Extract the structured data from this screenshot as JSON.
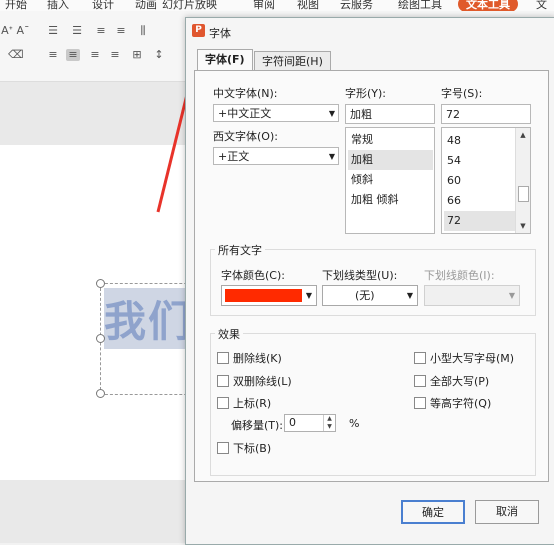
{
  "ribbon": {
    "menu": [
      "开始",
      "插入",
      "设计",
      "动画",
      "幻灯片放映",
      "审阅",
      "视图",
      "云服务",
      "绘图工具",
      "文本工具",
      "文"
    ]
  },
  "slide": {
    "text": "我们"
  },
  "dialog": {
    "title": "字体",
    "tabs": [
      "字体(F)",
      "字符间距(H)"
    ],
    "cn_font_label": "中文字体(N):",
    "cn_font_value": "+中文正文",
    "western_font_label": "西文字体(O):",
    "western_font_value": "+正文",
    "style_label": "字形(Y):",
    "style_value": "加粗",
    "style_options": [
      "常规",
      "加粗",
      "倾斜",
      "加粗 倾斜"
    ],
    "style_selected": "加粗",
    "size_label": "字号(S):",
    "size_value": "72",
    "size_options": [
      "48",
      "54",
      "60",
      "66",
      "72"
    ],
    "size_selected": "72",
    "all_text_title": "所有文字",
    "color_label": "字体颜色(C):",
    "color_value": "#ff2a00",
    "underline_label": "下划线类型(U):",
    "underline_value": "(无)",
    "underline_color_label": "下划线颜色(I):",
    "effects_title": "效果",
    "effects_left": [
      "删除线(K)",
      "双删除线(L)",
      "上标(R)"
    ],
    "offset_label": "偏移量(T):",
    "offset_value": "0",
    "offset_unit": "%",
    "subscript_label": "下标(B)",
    "effects_right": [
      "小型大写字母(M)",
      "全部大写(P)",
      "等高字符(Q)"
    ],
    "ok_label": "确定",
    "cancel_label": "取消"
  },
  "colors": {
    "accent": "#e05a2b",
    "font_color": "#ff2a00",
    "annotation_arrow": "#e8332a"
  }
}
